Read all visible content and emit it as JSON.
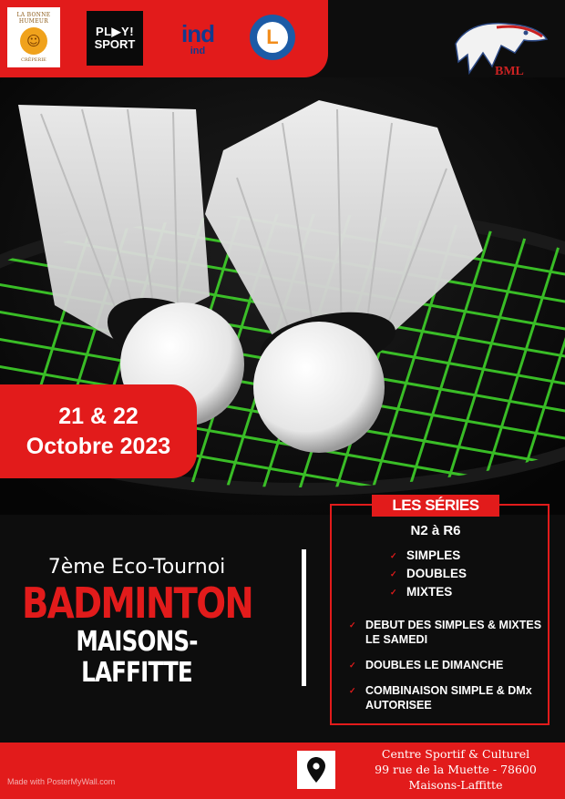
{
  "sponsors": {
    "bonne_humeur": {
      "arc_text": "LA BONNE HUMEUR",
      "sub_text": "CRÊPERIE"
    },
    "play_sport": {
      "line1": "PL▶Y!",
      "line2": "SPORT"
    },
    "ind": {
      "line1": "ind",
      "line2": "ind"
    },
    "leclerc": {
      "letter": "L"
    }
  },
  "club_logo": {
    "text": "BML"
  },
  "date": {
    "line1": "21 & 22",
    "line2": "Octobre 2023"
  },
  "tournament": {
    "edition": "7ème Eco-Tournoi",
    "sport": "BADMINTON",
    "city": "MAISONS-LAFFITTE"
  },
  "series": {
    "tag": "LES SÉRIES",
    "range": "N2 à R6",
    "types": [
      "SIMPLES",
      "DOUBLES",
      "MIXTES"
    ],
    "info": [
      "DEBUT DES SIMPLES & MIXTES LE SAMEDI",
      "DOUBLES LE DIMANCHE",
      "COMBINAISON SIMPLE & DMx AUTORISEE"
    ]
  },
  "venue": {
    "line1": "Centre Sportif & Culturel",
    "line2": "99 rue de la Muette - 78600",
    "line3": "Maisons-Laffitte"
  },
  "watermark": "Made with PosterMyWall.com",
  "colors": {
    "accent": "#e21b1b",
    "background": "#0d0d0d",
    "strings": "#4cd62e"
  },
  "icons": {
    "venue": "map-pin-icon",
    "check": "check-icon"
  }
}
